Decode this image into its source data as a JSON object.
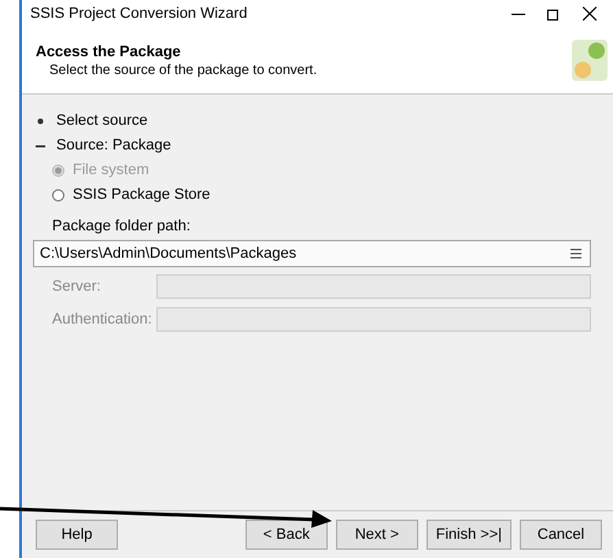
{
  "window": {
    "title": "SSIS Project Conversion Wizard"
  },
  "header": {
    "title": "Access the Package",
    "subtitle": "Select the source of the package to convert."
  },
  "sections": [
    {
      "label": "Select source",
      "expanded": false
    },
    {
      "label": "Source: Package",
      "expanded": true
    }
  ],
  "options": [
    {
      "label": "File system",
      "selected": true,
      "disabled": true
    },
    {
      "label": "SSIS Package Store",
      "selected": false,
      "disabled": false
    }
  ],
  "path": {
    "label": "Package folder path:",
    "value": "C:\\Users\\Admin\\Documents\\Packages"
  },
  "fields": [
    {
      "label": "Server:",
      "disabled": true
    },
    {
      "label": "Authentication:",
      "disabled": true
    }
  ],
  "buttons": [
    {
      "label": "Help",
      "kind": "left"
    },
    {
      "label": "< Back",
      "kind": "right"
    },
    {
      "label": "Next >",
      "kind": "right"
    },
    {
      "label": "Finish >>|",
      "kind": "right"
    },
    {
      "label": "Cancel",
      "kind": "right"
    }
  ]
}
